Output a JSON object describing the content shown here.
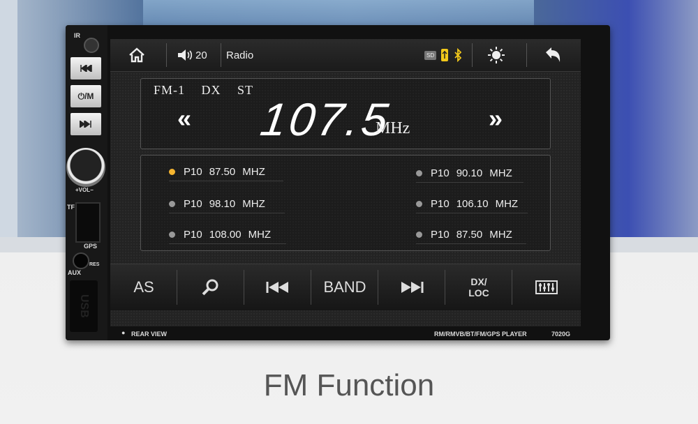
{
  "side": {
    "ir_label": "IR",
    "vol_label": "+VOL−",
    "tf_label": "TF",
    "gps_label": "GPS",
    "res_label": "RES",
    "aux_label": "AUX",
    "usb_label": "USB",
    "power_label": "⏻/M"
  },
  "topbar": {
    "volume_value": "20",
    "source_label": "Radio",
    "sd_label": "SD"
  },
  "tuner": {
    "band": "FM-1",
    "dx": "DX",
    "stereo": "ST",
    "frequency": "107.5",
    "unit": "MHz"
  },
  "presets": [
    {
      "slot": "P10",
      "freq": "87.50",
      "unit": "MHZ",
      "active": true
    },
    {
      "slot": "P10",
      "freq": "90.10",
      "unit": "MHZ",
      "active": false
    },
    {
      "slot": "P10",
      "freq": "98.10",
      "unit": "MHZ",
      "active": false
    },
    {
      "slot": "P10",
      "freq": "106.10",
      "unit": "MHZ",
      "active": false
    },
    {
      "slot": "P10",
      "freq": "108.00",
      "unit": "MHZ",
      "active": false
    },
    {
      "slot": "P10",
      "freq": "87.50",
      "unit": "MHZ",
      "active": false
    }
  ],
  "bottombar": {
    "as_label": "AS",
    "band_label": "BAND",
    "dxloc_top": "DX/",
    "dxloc_bottom": "LOC"
  },
  "footer": {
    "rear_view": "REAR VIEW",
    "formats": "RM/RMVB/BT/FM/GPS PLAYER",
    "model": "7020G"
  },
  "caption": "FM Function",
  "colors": {
    "active_preset": "#f6b530",
    "usb_icon": "#f2c81a",
    "bluetooth_icon": "#f2c81a"
  }
}
